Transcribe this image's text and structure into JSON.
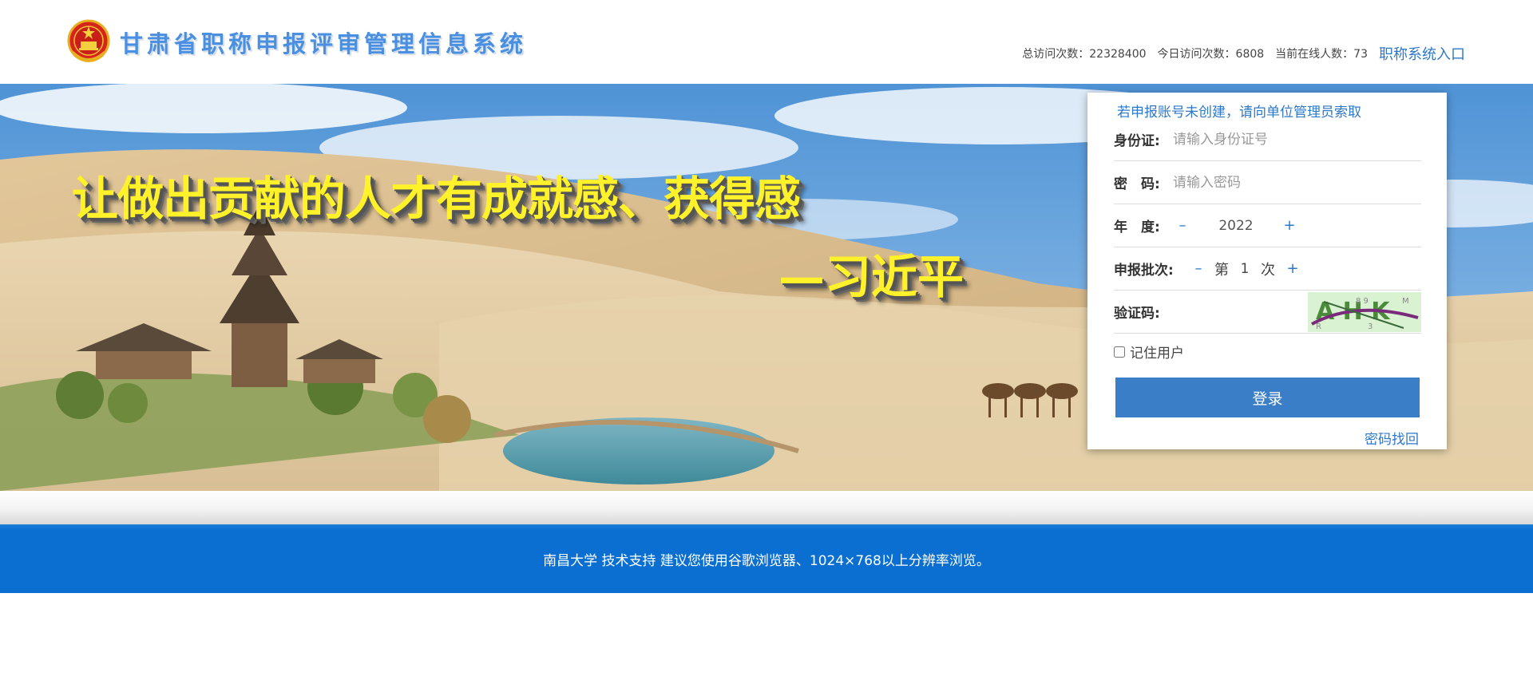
{
  "header": {
    "title": "甘肃省职称申报评审管理信息系统",
    "stats": {
      "total_label": "总访问次数：",
      "total_value": "22328400",
      "today_label": "今日访问次数：",
      "today_value": "6808",
      "online_label": "当前在线人数：",
      "online_value": "73"
    },
    "entry_link": "职称系统入口"
  },
  "banner": {
    "slogan_line1": "让做出贡献的人才有成就感、获得感",
    "slogan_line2": "—习近平"
  },
  "login": {
    "hint": "若申报账号未创建，请向单位管理员索取",
    "id_label": "身份证:",
    "id_placeholder": "请输入身份证号",
    "password_label": "密　码:",
    "password_placeholder": "请输入密码",
    "year_label": "年　度:",
    "year_minus": "–",
    "year_value": "2022",
    "year_plus": "+",
    "batch_label": "申报批次:",
    "batch_minus": "–",
    "batch_prefix": "第",
    "batch_value": "1",
    "batch_suffix": "次",
    "batch_plus": "+",
    "captcha_label": "验证码:",
    "captcha_chars": "A H K",
    "remember_label": "记住用户",
    "submit_label": "登录",
    "forgot_link": "密码找回"
  },
  "footer": {
    "text": "南昌大学 技术支持 建议您使用谷歌浏览器、1024×768以上分辨率浏览。"
  },
  "colors": {
    "accent": "#2e78c8",
    "button": "#3a7ec7",
    "footer_bg": "#0a6fd1",
    "slogan": "#fff22a",
    "title": "#4a8fe0"
  }
}
